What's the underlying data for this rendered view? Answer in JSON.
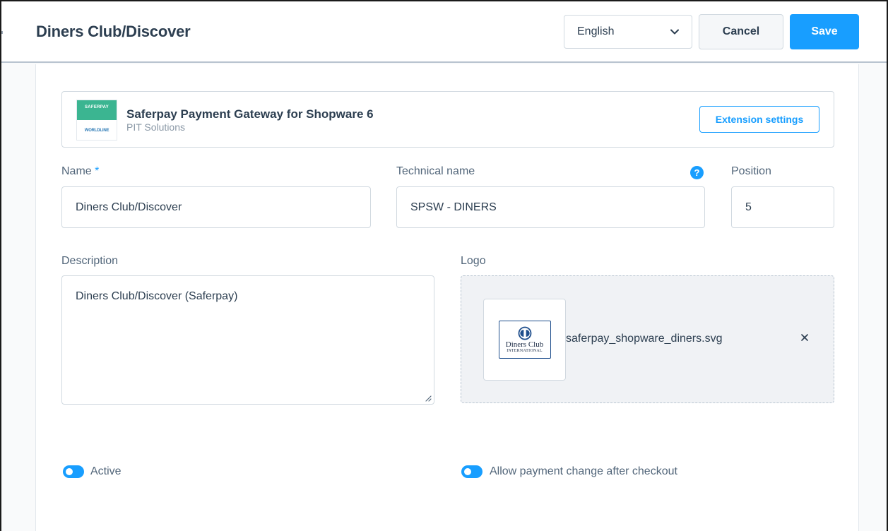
{
  "header": {
    "title": "Diners Club/Discover",
    "language": "English",
    "cancel_label": "Cancel",
    "save_label": "Save"
  },
  "extension": {
    "logo_top_text": "SAFERPAY",
    "logo_bottom_text": "WORLDLINE",
    "name": "Saferpay Payment Gateway for Shopware 6",
    "vendor": "PIT Solutions",
    "settings_label": "Extension settings"
  },
  "form": {
    "name_label": "Name",
    "name_required_mark": "*",
    "name_value": "Diners Club/Discover",
    "technical_name_label": "Technical name",
    "technical_name_value": "SPSW - DINERS",
    "help_icon": "?",
    "position_label": "Position",
    "position_value": "5",
    "description_label": "Description",
    "description_value": "Diners Club/Discover (Saferpay)",
    "logo_label": "Logo",
    "logo_file_name": "saferpay_shopware_diners.svg",
    "logo_brand_line1": "Diners Club",
    "logo_brand_line2": "INTERNATIONAL",
    "active_label": "Active",
    "active_on": true,
    "after_order_label": "Allow payment change after checkout",
    "after_order_on": true
  },
  "colors": {
    "accent": "#189eff",
    "title": "#2c3e50",
    "border": "#d1d9e0"
  },
  "icons": [
    "chevron-down-icon",
    "help-icon",
    "close-icon",
    "resize-handle-icon"
  ]
}
